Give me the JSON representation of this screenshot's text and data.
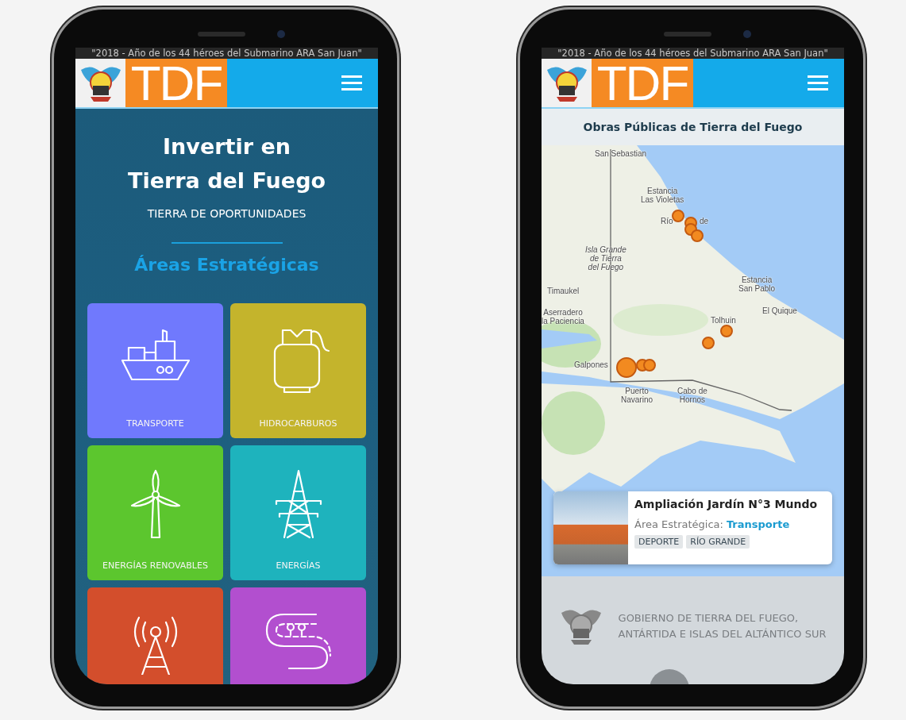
{
  "screens": [
    {
      "kind": "areas",
      "banner": "\"2018 - Año de los 44 héroes del Submarino ARA San Juan\"",
      "logo_text": "TDF",
      "hero": {
        "title_lines": [
          "Invertir en",
          "Tierra del Fuego"
        ],
        "subtitle": "TIERRA DE OPORTUNIDADES",
        "section_title": "Áreas Estratégicas"
      },
      "areas": [
        {
          "label": "TRANSPORTE",
          "kind": "ship",
          "color": "#7079fd"
        },
        {
          "label": "HIDROCARBUROS",
          "kind": "cylinder",
          "color": "#c4b42c"
        },
        {
          "label": "ENERGÍAS RENOVABLES",
          "kind": "turbine",
          "color": "#5cc62e"
        },
        {
          "label": "ENERGÍAS",
          "kind": "pylon",
          "color": "#1eb3bd"
        },
        {
          "kind": "antenna",
          "color": "#d34e2c"
        },
        {
          "kind": "road",
          "color": "#b24fcf"
        }
      ]
    },
    {
      "kind": "map",
      "banner": "\"2018 - Año de los 44 héroes del Submarino ARA San Juan\"",
      "logo_text": "TDF",
      "title": "Obras Públicas de Tierra del Fuego",
      "map_labels": [
        {
          "kind": "place",
          "lines": [
            "San Sebastian"
          ]
        },
        {
          "kind": "place",
          "lines": [
            "Estancia",
            "Las Violetas"
          ]
        },
        {
          "kind": "place",
          "lines": [
            "Río"
          ]
        },
        {
          "kind": "place",
          "lines": [
            "de"
          ]
        },
        {
          "kind": "island",
          "lines": [
            "Isla Grande",
            "de Tierra",
            "del Fuego"
          ]
        },
        {
          "kind": "place",
          "lines": [
            "Timaukel"
          ]
        },
        {
          "kind": "place",
          "lines": [
            "Aserradero",
            "la Paciencia"
          ]
        },
        {
          "kind": "place",
          "lines": [
            "Estancia",
            "San Pablo"
          ]
        },
        {
          "kind": "place",
          "lines": [
            "El Quique"
          ]
        },
        {
          "kind": "place",
          "lines": [
            "Tolhuin"
          ]
        },
        {
          "kind": "place",
          "lines": [
            "Galpones"
          ]
        },
        {
          "kind": "place",
          "lines": [
            "Puerto",
            "Navarino"
          ]
        },
        {
          "kind": "place",
          "lines": [
            "Cabo de",
            "Hornos"
          ]
        }
      ],
      "project_card": {
        "title": "Ampliación Jardín N°3 Mundo",
        "area_label": "Área Estratégica:",
        "area_value": "Transporte",
        "tags": [
          "DEPORTE",
          "RÍO GRANDE"
        ]
      },
      "footer": {
        "lines": [
          "GOBIERNO DE TIERRA DEL FUEGO,",
          "ANTÁRTIDA E ISLAS DEL ALTÁNTICO SUR"
        ]
      }
    }
  ]
}
